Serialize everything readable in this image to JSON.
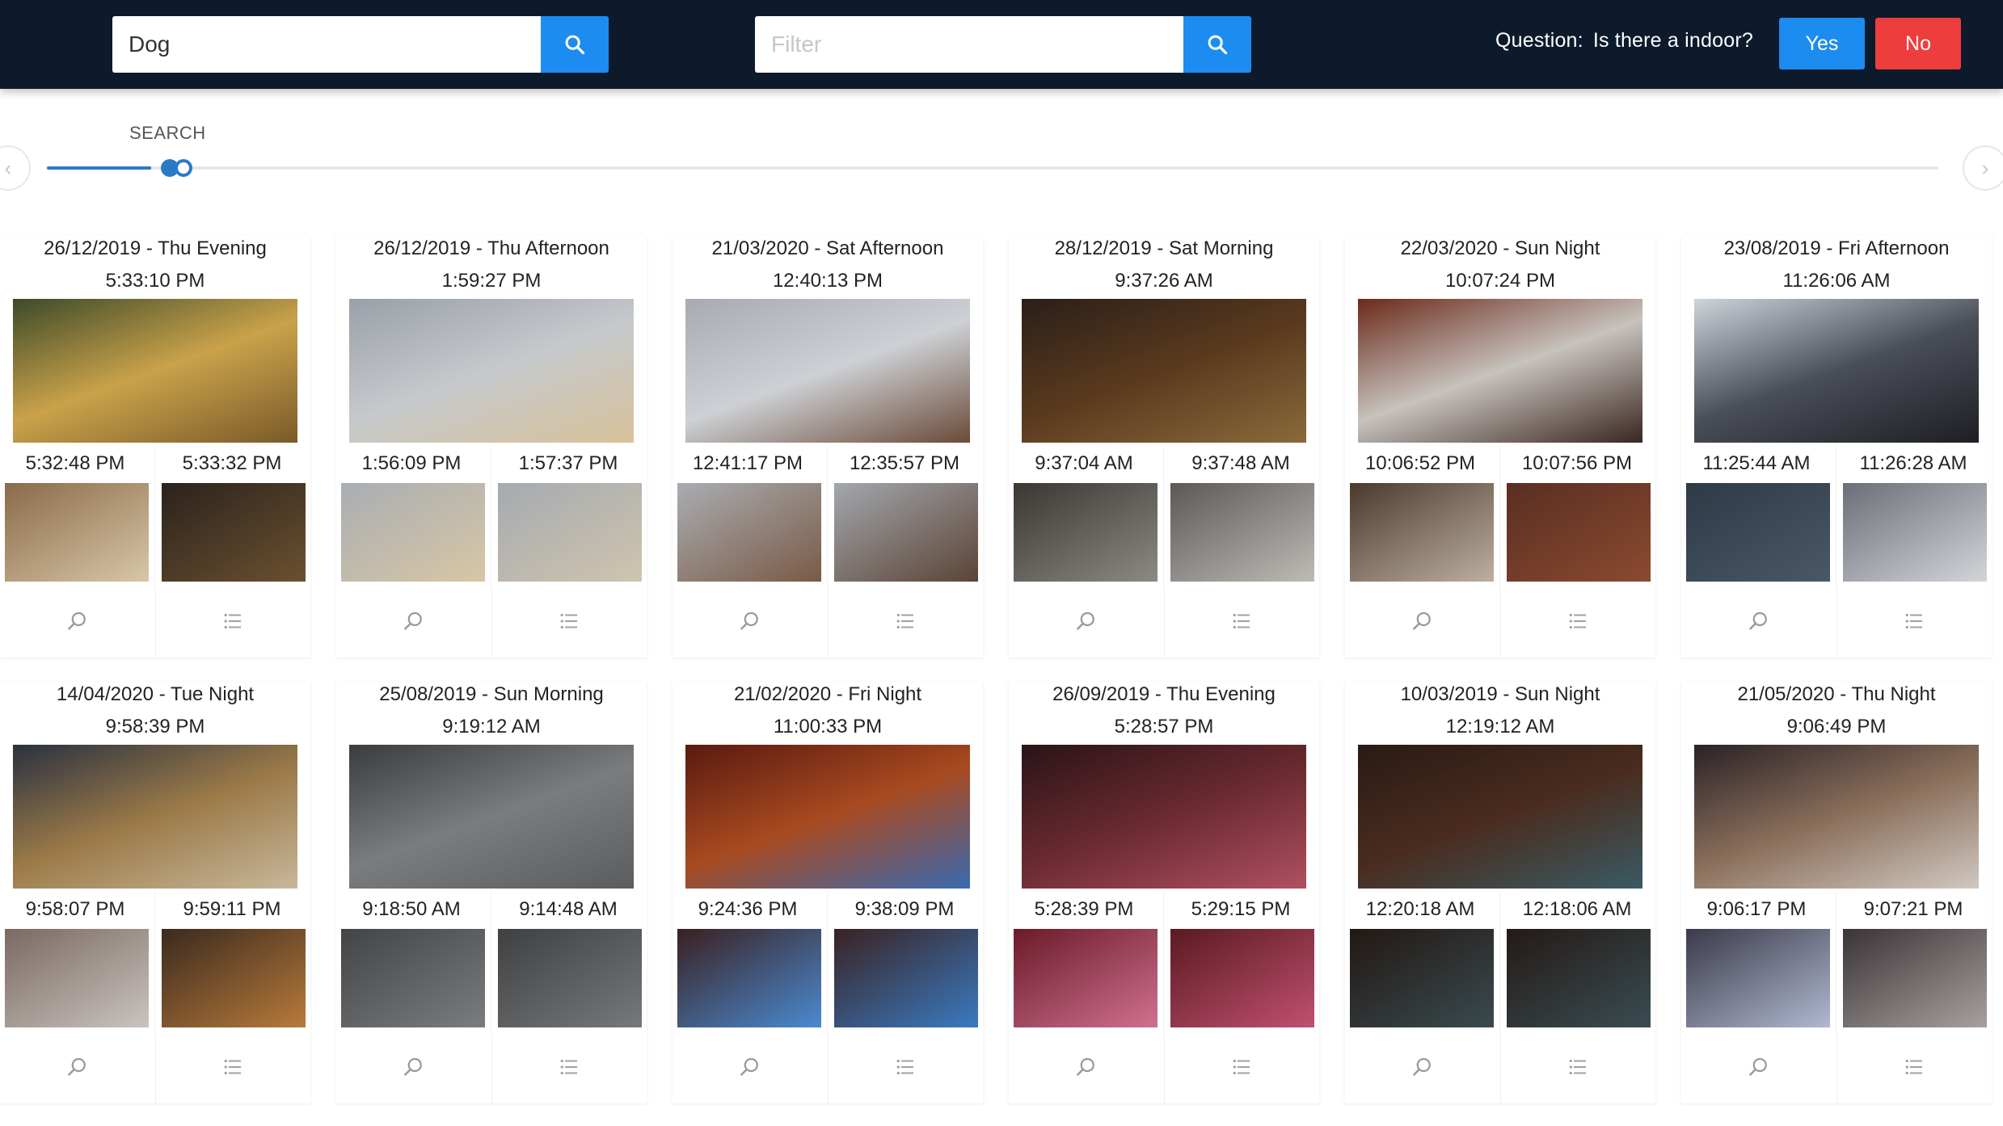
{
  "topbar": {
    "search": {
      "value": "Dog",
      "placeholder": ""
    },
    "filter": {
      "value": "",
      "placeholder": "Filter"
    },
    "question_label": "Question:",
    "question_text": "Is there a indoor?",
    "yes_label": "Yes",
    "no_label": "No",
    "colors": {
      "bar": "#0d1a2c",
      "accent": "#1d8cf0",
      "danger": "#ee3d3d"
    }
  },
  "slider": {
    "label": "SEARCH",
    "level": 0.05,
    "prev_icon": "‹",
    "next_icon": "›"
  },
  "cards": [
    {
      "date": "26/12/2019 - Thu Evening",
      "time": "5:33:10 PM",
      "left_time": "5:32:48 PM",
      "right_time": "5:33:32 PM",
      "main_colors": [
        "#3d4a2a",
        "#c9a24a",
        "#7a5a2a"
      ],
      "left_colors": [
        "#8a6a4a",
        "#d8c7a8"
      ],
      "right_colors": [
        "#2b231c",
        "#6b5030"
      ]
    },
    {
      "date": "26/12/2019 - Thu Afternoon",
      "time": "1:59:27 PM",
      "left_time": "1:56:09 PM",
      "right_time": "1:57:37 PM",
      "main_colors": [
        "#9aa0a8",
        "#c6c9cc",
        "#d8c29a"
      ],
      "left_colors": [
        "#a9adb3",
        "#d7c7a4"
      ],
      "right_colors": [
        "#a5aab0",
        "#cfc4ae"
      ]
    },
    {
      "date": "21/03/2020 - Sat Afternoon",
      "time": "12:40:13 PM",
      "left_time": "12:41:17 PM",
      "right_time": "12:35:57 PM",
      "main_colors": [
        "#a7abb1",
        "#cdd0d4",
        "#6a4a38"
      ],
      "left_colors": [
        "#a9adb2",
        "#7a5a45"
      ],
      "right_colors": [
        "#a3a7ad",
        "#5b4436"
      ]
    },
    {
      "date": "28/12/2019 - Sat Morning",
      "time": "9:37:26 AM",
      "left_time": "9:37:04 AM",
      "right_time": "9:37:48 AM",
      "main_colors": [
        "#2b1f18",
        "#5a3a1e",
        "#8a6a3a"
      ],
      "left_colors": [
        "#3a3632",
        "#8d8a86"
      ],
      "right_colors": [
        "#5b5855",
        "#bfbcb8"
      ]
    },
    {
      "date": "22/03/2020 - Sun Night",
      "time": "10:07:24 PM",
      "left_time": "10:06:52 PM",
      "right_time": "10:07:56 PM",
      "main_colors": [
        "#6b2a1a",
        "#c7c2bd",
        "#3a2620"
      ],
      "left_colors": [
        "#4b3a2c",
        "#bdb0a0"
      ],
      "right_colors": [
        "#5a2e22",
        "#8a4a30"
      ]
    },
    {
      "date": "23/08/2019 - Fri Afternoon",
      "time": "11:26:06 AM",
      "left_time": "11:25:44 AM",
      "right_time": "11:26:28 AM",
      "main_colors": [
        "#cfd3da",
        "#4a4e58",
        "#1d1f24"
      ],
      "left_colors": [
        "#2e3a46",
        "#4a5866"
      ],
      "right_colors": [
        "#6a6e76",
        "#d3d5d9"
      ]
    },
    {
      "date": "14/04/2020 - Tue Night",
      "time": "9:58:39 PM",
      "left_time": "9:58:07 PM",
      "right_time": "9:59:11 PM",
      "main_colors": [
        "#2a3140",
        "#9b7a48",
        "#c7b79a"
      ],
      "left_colors": [
        "#7a6a62",
        "#c9c3bf"
      ],
      "right_colors": [
        "#3a2a1e",
        "#b87a3a"
      ]
    },
    {
      "date": "25/08/2019 - Sun Morning",
      "time": "9:19:12 AM",
      "left_time": "9:18:50 AM",
      "right_time": "9:14:48 AM",
      "main_colors": [
        "#3a3c3e",
        "#7a7c7e",
        "#5a5c5e"
      ],
      "left_colors": [
        "#424446",
        "#7a7c7e"
      ],
      "right_colors": [
        "#3e4042",
        "#76787a"
      ]
    },
    {
      "date": "21/02/2020 - Fri Night",
      "time": "11:00:33 PM",
      "left_time": "9:24:36 PM",
      "right_time": "9:38:09 PM",
      "main_colors": [
        "#5a1a10",
        "#a84a20",
        "#3a6ab0"
      ],
      "left_colors": [
        "#3a2020",
        "#4a8ad0"
      ],
      "right_colors": [
        "#3a2222",
        "#3a7ac0"
      ]
    },
    {
      "date": "26/09/2019 - Thu Evening",
      "time": "5:28:57 PM",
      "left_time": "5:28:39 PM",
      "right_time": "5:29:15 PM",
      "main_colors": [
        "#2a1418",
        "#6a2a30",
        "#b05060"
      ],
      "left_colors": [
        "#6a1a2a",
        "#d07090"
      ],
      "right_colors": [
        "#5a1a22",
        "#c05070"
      ]
    },
    {
      "date": "10/03/2019 - Sun Night",
      "time": "12:19:12 AM",
      "left_time": "12:20:18 AM",
      "right_time": "12:18:06 AM",
      "main_colors": [
        "#2a1a14",
        "#4a2c1e",
        "#3a5a64"
      ],
      "left_colors": [
        "#221814",
        "#3a4a4e"
      ],
      "right_colors": [
        "#241a16",
        "#3a4c52"
      ]
    },
    {
      "date": "21/05/2020 - Thu Night",
      "time": "9:06:49 PM",
      "left_time": "9:06:17 PM",
      "right_time": "9:07:21 PM",
      "main_colors": [
        "#2a2226",
        "#8a6e5a",
        "#d0c8c0"
      ],
      "left_colors": [
        "#3a3a4a",
        "#b0b8d0"
      ],
      "right_colors": [
        "#3a3436",
        "#a8a0a0"
      ]
    }
  ]
}
